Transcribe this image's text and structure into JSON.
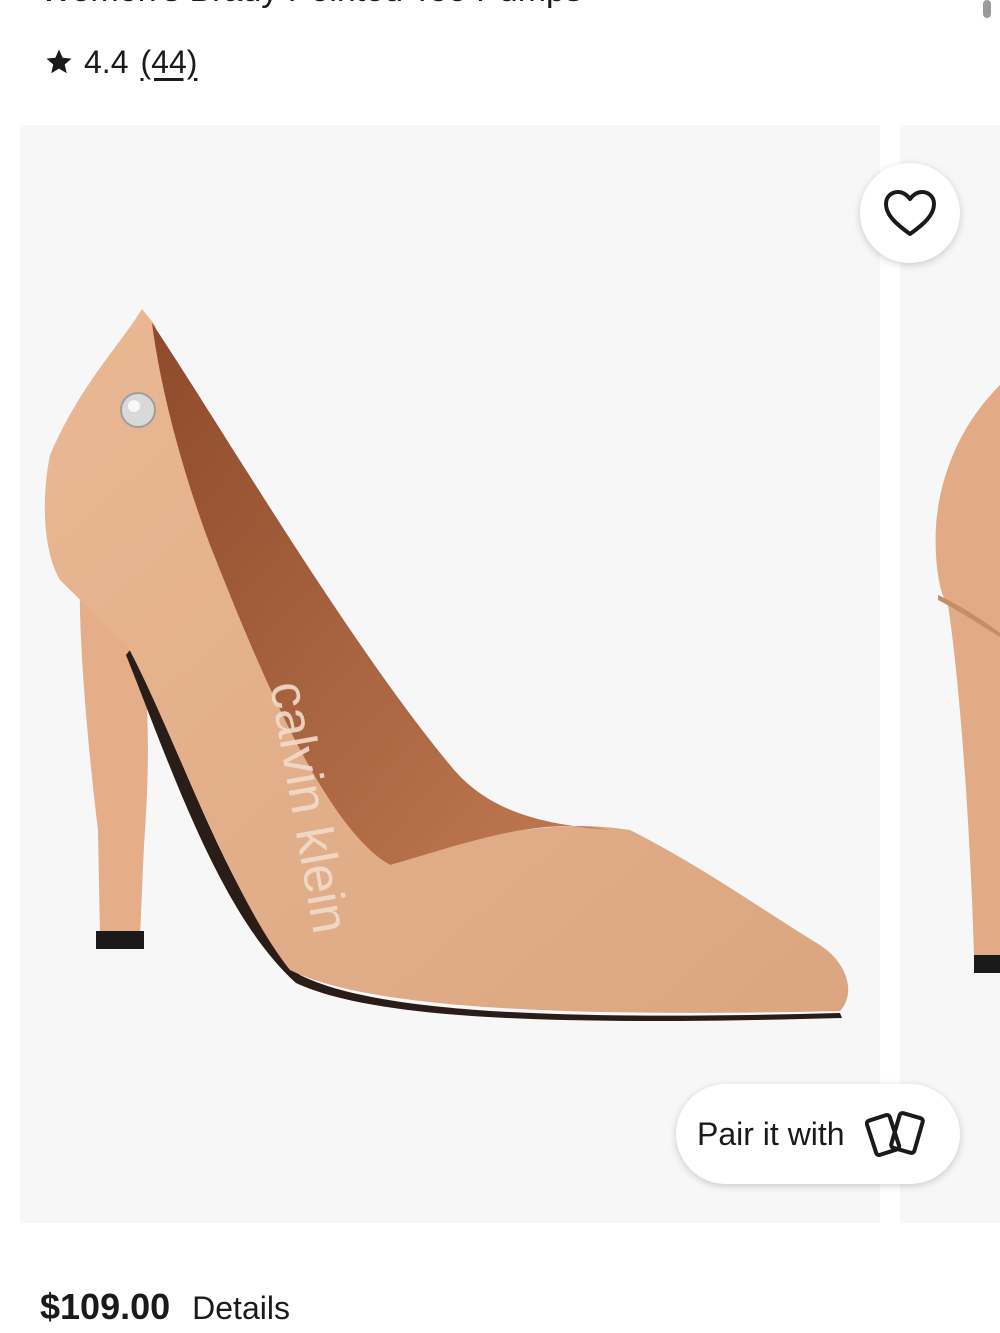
{
  "product": {
    "title": "Women's Brady Pointed Toe Pumps",
    "rating": "4.4",
    "review_count": "(44)",
    "price": "$109.00",
    "details_label": "Details"
  },
  "gallery": {
    "image_alt": "Nude pointed toe high heel pump",
    "insole_brand_text": "calvin klein",
    "pair_label": "Pair it with"
  },
  "icons": {
    "rating": "star-icon",
    "favorite": "heart-icon",
    "pair": "cards-icon"
  },
  "colors": {
    "shoe": "#e6b28e",
    "insole": "#b5673f",
    "background": "#f7f7f7"
  }
}
